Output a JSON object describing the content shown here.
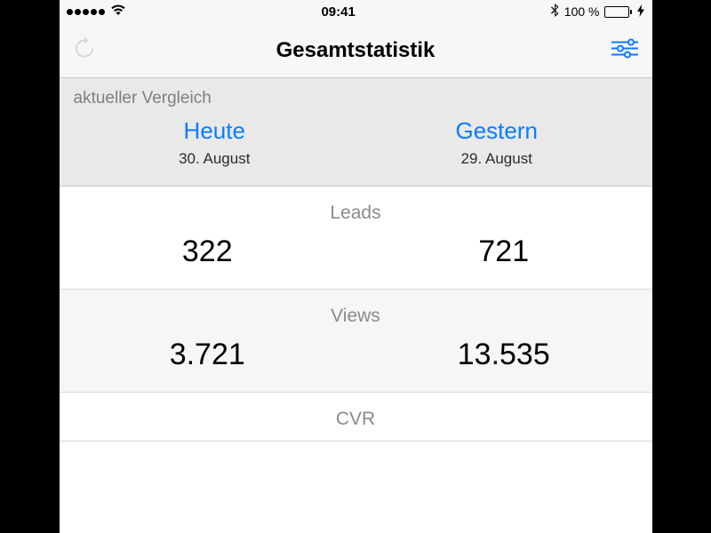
{
  "statusbar": {
    "time": "09:41",
    "battery_pct": "100 %"
  },
  "navbar": {
    "title": "Gesamtstatistik"
  },
  "comparison": {
    "caption": "aktueller Vergleich",
    "left": {
      "label": "Heute",
      "date": "30. August"
    },
    "right": {
      "label": "Gestern",
      "date": "29. August"
    }
  },
  "metrics": [
    {
      "title": "Leads",
      "left": "322",
      "right": "721"
    },
    {
      "title": "Views",
      "left": "3.721",
      "right": "13.535"
    },
    {
      "title": "CVR",
      "left": "",
      "right": ""
    }
  ]
}
